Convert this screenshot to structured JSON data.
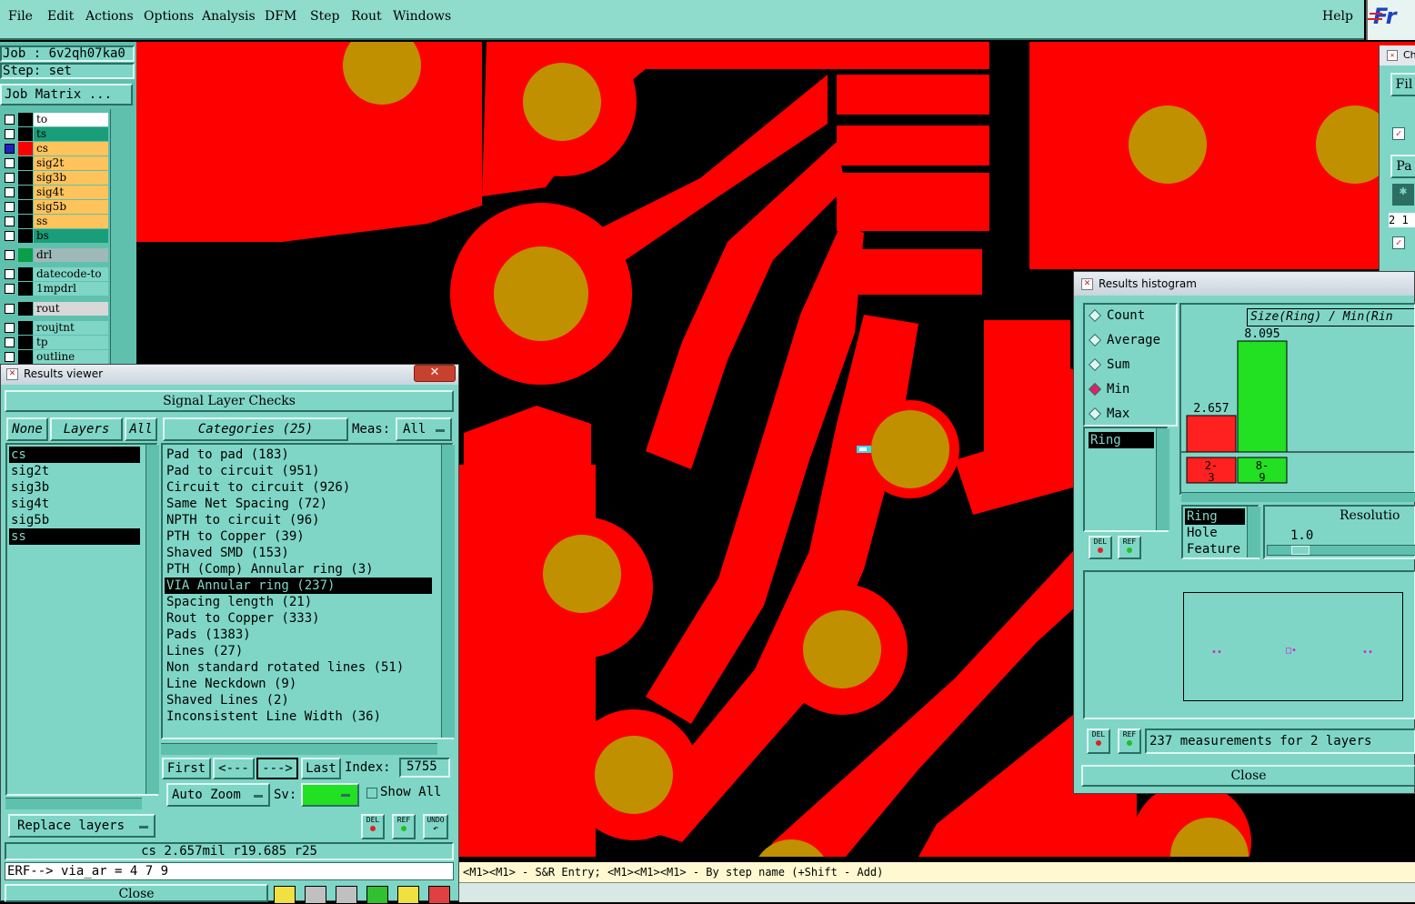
{
  "menu": {
    "items": [
      "File",
      "Edit",
      "Actions",
      "Options",
      "Analysis",
      "DFM",
      "Step",
      "Rout",
      "Windows"
    ],
    "help": "Help",
    "logo": "Fr"
  },
  "job": {
    "job_line": "Job : 6v2qh07ka0",
    "step_line": "Step: set",
    "matrix_button": "Job Matrix ..."
  },
  "layers": [
    {
      "name": "to",
      "color": "#ffffff",
      "swatch": "#000000"
    },
    {
      "name": "ts",
      "color": "#1a9e7a",
      "swatch": "#000000"
    },
    {
      "name": "cs",
      "color": "#ffc35c",
      "swatch": "#ff0000",
      "selected": true
    },
    {
      "name": "sig2t",
      "color": "#ffc35c",
      "swatch": "#000000"
    },
    {
      "name": "sig3b",
      "color": "#ffc35c",
      "swatch": "#000000"
    },
    {
      "name": "sig4t",
      "color": "#ffc35c",
      "swatch": "#000000"
    },
    {
      "name": "sig5b",
      "color": "#ffc35c",
      "swatch": "#000000"
    },
    {
      "name": "ss",
      "color": "#ffc35c",
      "swatch": "#000000"
    },
    {
      "name": "bs",
      "color": "#1a9e7a",
      "swatch": "#000000"
    },
    {
      "name": "drl",
      "color": "#9fb8b8",
      "swatch": "#0a9e4a"
    },
    {
      "name": "datecode-to",
      "color": "#7fd6c6",
      "swatch": "#000000"
    },
    {
      "name": "1mpdrl",
      "color": "#7fd6c6",
      "swatch": "#000000"
    },
    {
      "name": "rout",
      "color": "#d8d8d8",
      "swatch": "#000000"
    },
    {
      "name": "roujtnt",
      "color": "#7fd6c6",
      "swatch": "#000000"
    },
    {
      "name": "tp",
      "color": "#7fd6c6",
      "swatch": "#000000"
    },
    {
      "name": "outline",
      "color": "#7fd6c6",
      "swatch": "#000000"
    }
  ],
  "results_viewer": {
    "title": "Results viewer",
    "header": "Signal Layer Checks",
    "none_btn": "None",
    "layers_btn": "Layers",
    "all_btn": "All",
    "categories_btn": "Categories (25)",
    "meas_label": "Meas:",
    "meas_value": "All",
    "layer_list": [
      "cs",
      "sig2t",
      "sig3b",
      "sig4t",
      "sig5b",
      "ss"
    ],
    "categories": [
      "Pad to pad (183)",
      "Pad to circuit (951)",
      "Circuit to circuit (926)",
      "Same Net Spacing (72)",
      "NPTH to circuit (96)",
      "PTH to Copper (39)",
      "Shaved SMD (153)",
      "PTH (Comp) Annular ring (3)",
      "VIA Annular ring (237)",
      "Spacing length (21)",
      "Rout to Copper (333)",
      "Pads (1383)",
      "Lines (27)",
      "Non standard rotated lines (51)",
      "Line Neckdown (9)",
      "Shaved Lines (2)",
      "Inconsistent Line Width (36)"
    ],
    "first_btn": "First",
    "prev_btn": "<---",
    "next_btn": "--->",
    "last_btn": "Last",
    "index_label": "Index:",
    "index_value": "5755",
    "autozoom_btn": "Auto Zoom",
    "sv_label": "Sv:",
    "show_all": "Show All",
    "replace_btn": "Replace layers",
    "del_label": "DEL",
    "ref_label": "REF",
    "undo_label": "UNDO",
    "status_line": "cs 2.657mil  r19.685  r25",
    "erf_line": "ERF--> via_ar = 4 7 9",
    "close_btn": "Close"
  },
  "histogram": {
    "title": "Results histogram",
    "modes": [
      "Count",
      "Average",
      "Sum",
      "Min",
      "Max"
    ],
    "selected_mode": "Min",
    "measure_list": [
      "Ring"
    ],
    "chart_title": "Size(Ring) / Min(Rin",
    "bars": [
      {
        "label": "2.657",
        "bin": "2-\n3",
        "value": 2.657,
        "color": "#ff2020"
      },
      {
        "label": "8.095",
        "bin": "8-\n9",
        "value": 8.095,
        "color": "#22e022"
      }
    ],
    "ymax": 8.095,
    "feature_list": [
      "Ring",
      "Hole",
      "Feature"
    ],
    "resolution_label": "Resolutio",
    "resolution_value": "1.0",
    "summary": "237 measurements for 2 layers",
    "close_btn": "Close",
    "del_label": "DEL",
    "ref_label": "REF"
  },
  "status_bar": "<M1><M1> - S&R Entry; <M1><M1><M1> - By step name (+Shift - Add)",
  "right_partial": {
    "title": "Ch",
    "btn1": "Fil",
    "btn2": "Pa",
    "value": "2 1"
  }
}
